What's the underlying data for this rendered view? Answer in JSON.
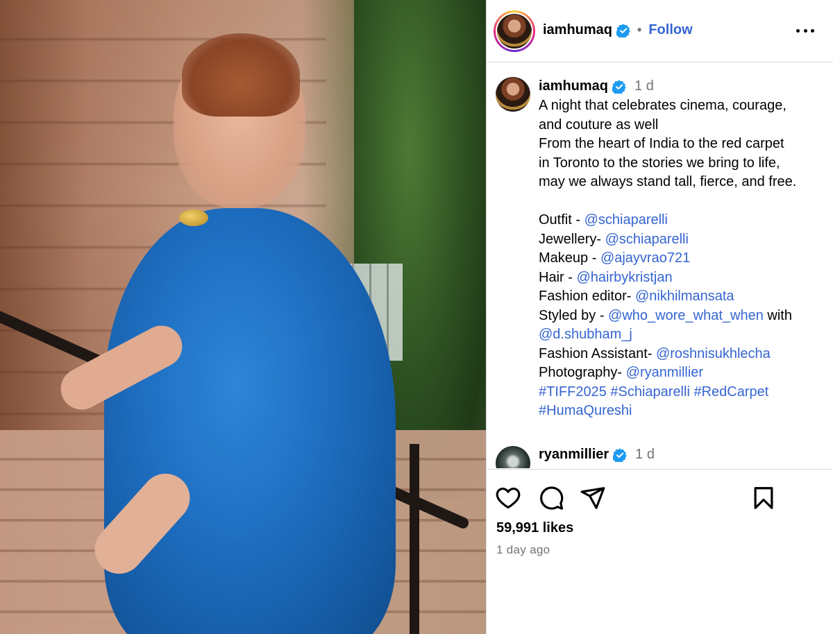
{
  "post": {
    "username": "iamhumaq",
    "follow_label": "Follow",
    "separator": "•"
  },
  "caption": {
    "username": "iamhumaq",
    "time": "1 d",
    "lines": [
      "A night that celebrates cinema, courage,",
      "and couture as well",
      "From the heart of India to the red carpet",
      "in Toronto to the stories we bring to life,",
      "may we always stand tall, fierce, and free."
    ],
    "credits": [
      {
        "label": "Outfit - ",
        "mention": "@schiaparelli"
      },
      {
        "label": "Jewellery- ",
        "mention": "@schiaparelli"
      },
      {
        "label": "Makeup - ",
        "mention": "@ajayvrao721"
      },
      {
        "label": "Hair - ",
        "mention": "@hairbykristjan"
      },
      {
        "label": "Fashion editor- ",
        "mention": "@nikhilmansata"
      }
    ],
    "styled_by_label": "Styled by - ",
    "styled_by_mention": "@who_wore_what_when",
    "styled_by_with": " with",
    "styled_by_mention2": "@d.shubham_j",
    "credits2": [
      {
        "label": "Fashion Assistant- ",
        "mention": "@roshnisukhlecha"
      },
      {
        "label": "Photography- ",
        "mention": "@ryanmillier"
      }
    ],
    "hashtags_line1": "#TIFF2025 #Schiaparelli #RedCarpet",
    "hashtags_line2": "#HumaQureshi"
  },
  "comment": {
    "username": "ryanmillier",
    "time": "1 d"
  },
  "stats": {
    "likes": "59,991 likes",
    "posted": "1 day ago"
  },
  "icons": [
    "verified-badge-icon",
    "more-options-icon",
    "heart-icon",
    "comment-icon",
    "share-icon",
    "bookmark-icon"
  ],
  "colors": {
    "link": "#3565d1",
    "verified": "#1d9bf0",
    "muted": "#737373",
    "divider": "#dbdbdb"
  }
}
